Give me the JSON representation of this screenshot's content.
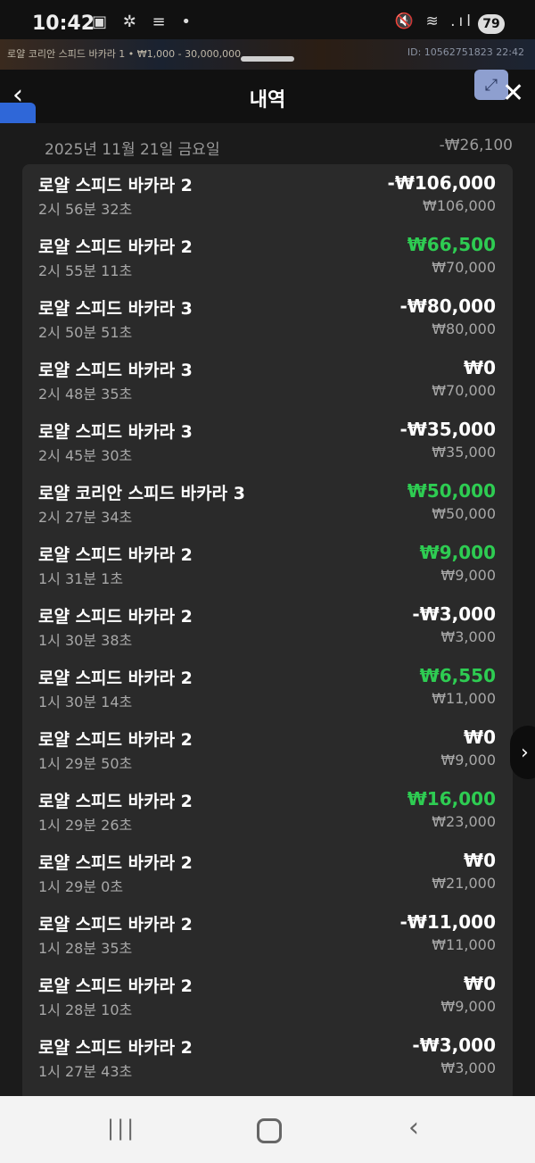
{
  "status_bar": {
    "time": "10:42",
    "left_icons": "▣ ✲ ≡ •",
    "right_icons": "🔇 ≋ .ıl",
    "battery": "79"
  },
  "game_strip": {
    "left_text": "로얄 코리안 스피드 바카라 1 • ₩1,000 - 30,000,000",
    "right_text": "ID: 10562751823 22:42"
  },
  "header": {
    "title": "내역",
    "back_icon": "‹",
    "close_icon": "✕",
    "expand_icon": "⤢"
  },
  "side_badge": {
    "icon": "🏆"
  },
  "date_header": {
    "date": "2025년 11월 21일 금요일",
    "total": "-₩26,100"
  },
  "rows": [
    {
      "name": "로얄 스피드 바카라 2",
      "time": "2시 56분 32초",
      "amount": "-₩106,000",
      "bet": "₩106,000",
      "win": false
    },
    {
      "name": "로얄 스피드 바카라 2",
      "time": "2시 55분 11초",
      "amount": "₩66,500",
      "bet": "₩70,000",
      "win": true
    },
    {
      "name": "로얄 스피드 바카라 3",
      "time": "2시 50분 51초",
      "amount": "-₩80,000",
      "bet": "₩80,000",
      "win": false
    },
    {
      "name": "로얄 스피드 바카라 3",
      "time": "2시 48분 35초",
      "amount": "₩0",
      "bet": "₩70,000",
      "win": false
    },
    {
      "name": "로얄 스피드 바카라 3",
      "time": "2시 45분 30초",
      "amount": "-₩35,000",
      "bet": "₩35,000",
      "win": false
    },
    {
      "name": "로얄 코리안 스피드 바카라 3",
      "time": "2시 27분 34초",
      "amount": "₩50,000",
      "bet": "₩50,000",
      "win": true
    },
    {
      "name": "로얄 스피드 바카라 2",
      "time": "1시 31분 1초",
      "amount": "₩9,000",
      "bet": "₩9,000",
      "win": true
    },
    {
      "name": "로얄 스피드 바카라 2",
      "time": "1시 30분 38초",
      "amount": "-₩3,000",
      "bet": "₩3,000",
      "win": false
    },
    {
      "name": "로얄 스피드 바카라 2",
      "time": "1시 30분 14초",
      "amount": "₩6,550",
      "bet": "₩11,000",
      "win": true
    },
    {
      "name": "로얄 스피드 바카라 2",
      "time": "1시 29분 50초",
      "amount": "₩0",
      "bet": "₩9,000",
      "win": false
    },
    {
      "name": "로얄 스피드 바카라 2",
      "time": "1시 29분 26초",
      "amount": "₩16,000",
      "bet": "₩23,000",
      "win": true
    },
    {
      "name": "로얄 스피드 바카라 2",
      "time": "1시 29분 0초",
      "amount": "₩0",
      "bet": "₩21,000",
      "win": false
    },
    {
      "name": "로얄 스피드 바카라 2",
      "time": "1시 28분 35초",
      "amount": "-₩11,000",
      "bet": "₩11,000",
      "win": false
    },
    {
      "name": "로얄 스피드 바카라 2",
      "time": "1시 28분 10초",
      "amount": "₩0",
      "bet": "₩9,000",
      "win": false
    },
    {
      "name": "로얄 스피드 바카라 2",
      "time": "1시 27분 43초",
      "amount": "-₩3,000",
      "bet": "₩3,000",
      "win": false
    }
  ],
  "colors": {
    "win": "#2ecc52",
    "background": "#1b1b1b",
    "card": "#2a2a2a"
  },
  "nav_bar": {
    "recents_icon": "|||",
    "back_icon": "‹"
  }
}
